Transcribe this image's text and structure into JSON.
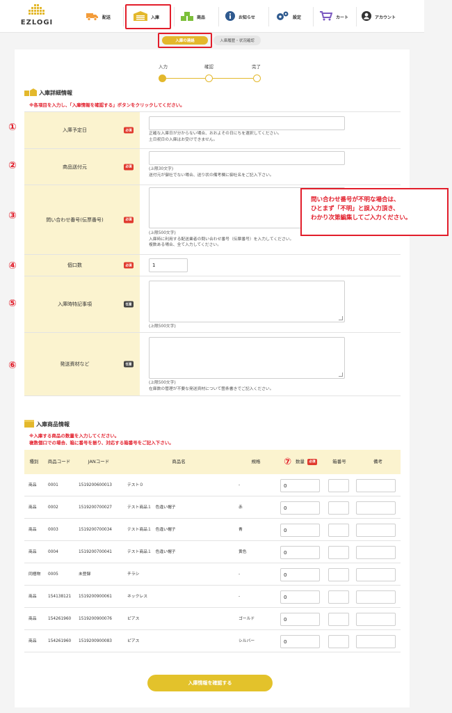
{
  "header": {
    "logo_text": "EZLOGI",
    "nav": [
      {
        "label": "配送",
        "icon": "truck-icon"
      },
      {
        "label": "入庫",
        "icon": "warehouse-icon"
      },
      {
        "label": "商品",
        "icon": "boxes-icon"
      },
      {
        "label": "お知らせ",
        "icon": "info-icon"
      },
      {
        "label": "設定",
        "icon": "gear-icon"
      },
      {
        "label": "カート",
        "icon": "cart-icon"
      },
      {
        "label": "アカウント",
        "icon": "account-icon"
      }
    ]
  },
  "subtabs": {
    "active": "入庫の連絡",
    "other": "入庫履歴・状況確認"
  },
  "steps": {
    "s1": "入力",
    "s2": "確認",
    "s3": "完了"
  },
  "detail": {
    "title": "入庫詳細情報",
    "note": "※各項目を入力し、「入庫情報を確認する」ボタンをクリックしてください。"
  },
  "badges": {
    "required": "必須",
    "optional": "任意"
  },
  "form": {
    "r1": {
      "num": "①",
      "label": "入庫予定日",
      "help1": "正確な入庫日が分からない場合、おおよその日にちを選択してください。",
      "help2": "土日祝日の入庫はお受けできません。"
    },
    "r2": {
      "num": "②",
      "label": "商品送付元",
      "help1": "(上限30文字)",
      "help2": "送付元が御社でない場合、送り状の備考欄に御社名をご記入下さい。"
    },
    "r3": {
      "num": "③",
      "label": "問い合わせ番号(伝票番号)",
      "help1": "(上限500文字)",
      "help2": "入庫時に利用する配送業者の問い合わせ番号（伝票番号）を入力してください。",
      "help3": "複数ある場合、全て入力してください。"
    },
    "r4": {
      "num": "④",
      "label": "個口数",
      "value": "1"
    },
    "r5": {
      "num": "⑤",
      "label": "入庫時特記事項",
      "help1": "(上限500文字)"
    },
    "r6": {
      "num": "⑥",
      "label": "発送資材など",
      "help1": "(上限500文字)",
      "help2": "在庫数の管理が不要な発送資材について箇条書きでご記入ください。"
    }
  },
  "callout": {
    "line1": "問い合わせ番号が不明な場合は、",
    "line2": "ひとまず「不明」と誤入力頂き、",
    "line3": "わかり次第編集してご入力ください。"
  },
  "products": {
    "title": "入庫商品情報",
    "note1": "※入庫する商品の数量を入力してください。",
    "note2": "複数個口での場合、箱に番号を振り、対応する箱番号をご記入下さい。",
    "qty_num": "⑦",
    "headers": {
      "type": "種別",
      "code": "商品コード",
      "jan": "JANコード",
      "name": "商品名",
      "spec": "規格",
      "qty": "数量",
      "box": "箱番号",
      "memo": "備考"
    },
    "rows": [
      {
        "type": "商品",
        "code": "0001",
        "jan": "1519200600013",
        "name": "テスト０",
        "spec": "-",
        "qty": "0"
      },
      {
        "type": "商品",
        "code": "0002",
        "jan": "1519200700027",
        "name": "テスト商品１　色違い帽子",
        "spec": "赤",
        "qty": "0"
      },
      {
        "type": "商品",
        "code": "0003",
        "jan": "1519200700034",
        "name": "テスト商品１　色違い帽子",
        "spec": "青",
        "qty": "0"
      },
      {
        "type": "商品",
        "code": "0004",
        "jan": "1519200700041",
        "name": "テスト商品１　色違い帽子",
        "spec": "黄色",
        "qty": "0"
      },
      {
        "type": "同梱物",
        "code": "0005",
        "jan": "未登録",
        "name": "チラシ",
        "spec": "-",
        "qty": "0"
      },
      {
        "type": "商品",
        "code": "154138121",
        "jan": "1519200900061",
        "name": "ネックレス",
        "spec": "-",
        "qty": "0"
      },
      {
        "type": "商品",
        "code": "154261960",
        "jan": "1519200900076",
        "name": "ピアス",
        "spec": "ゴールド",
        "qty": "0"
      },
      {
        "type": "商品",
        "code": "154261960",
        "jan": "1519200900083",
        "name": "ピアス",
        "spec": "シルバー",
        "qty": "0"
      }
    ]
  },
  "confirm_button": "入庫情報を確認する",
  "colors": {
    "accent": "#e3b82c",
    "red": "#e21d2a",
    "label_bg": "#fbf3cf",
    "nav_icon": "#2f5a8f",
    "nav_green": "#7cbf3a",
    "nav_orange": "#f39c3a",
    "nav_purple": "#7b58c0"
  }
}
